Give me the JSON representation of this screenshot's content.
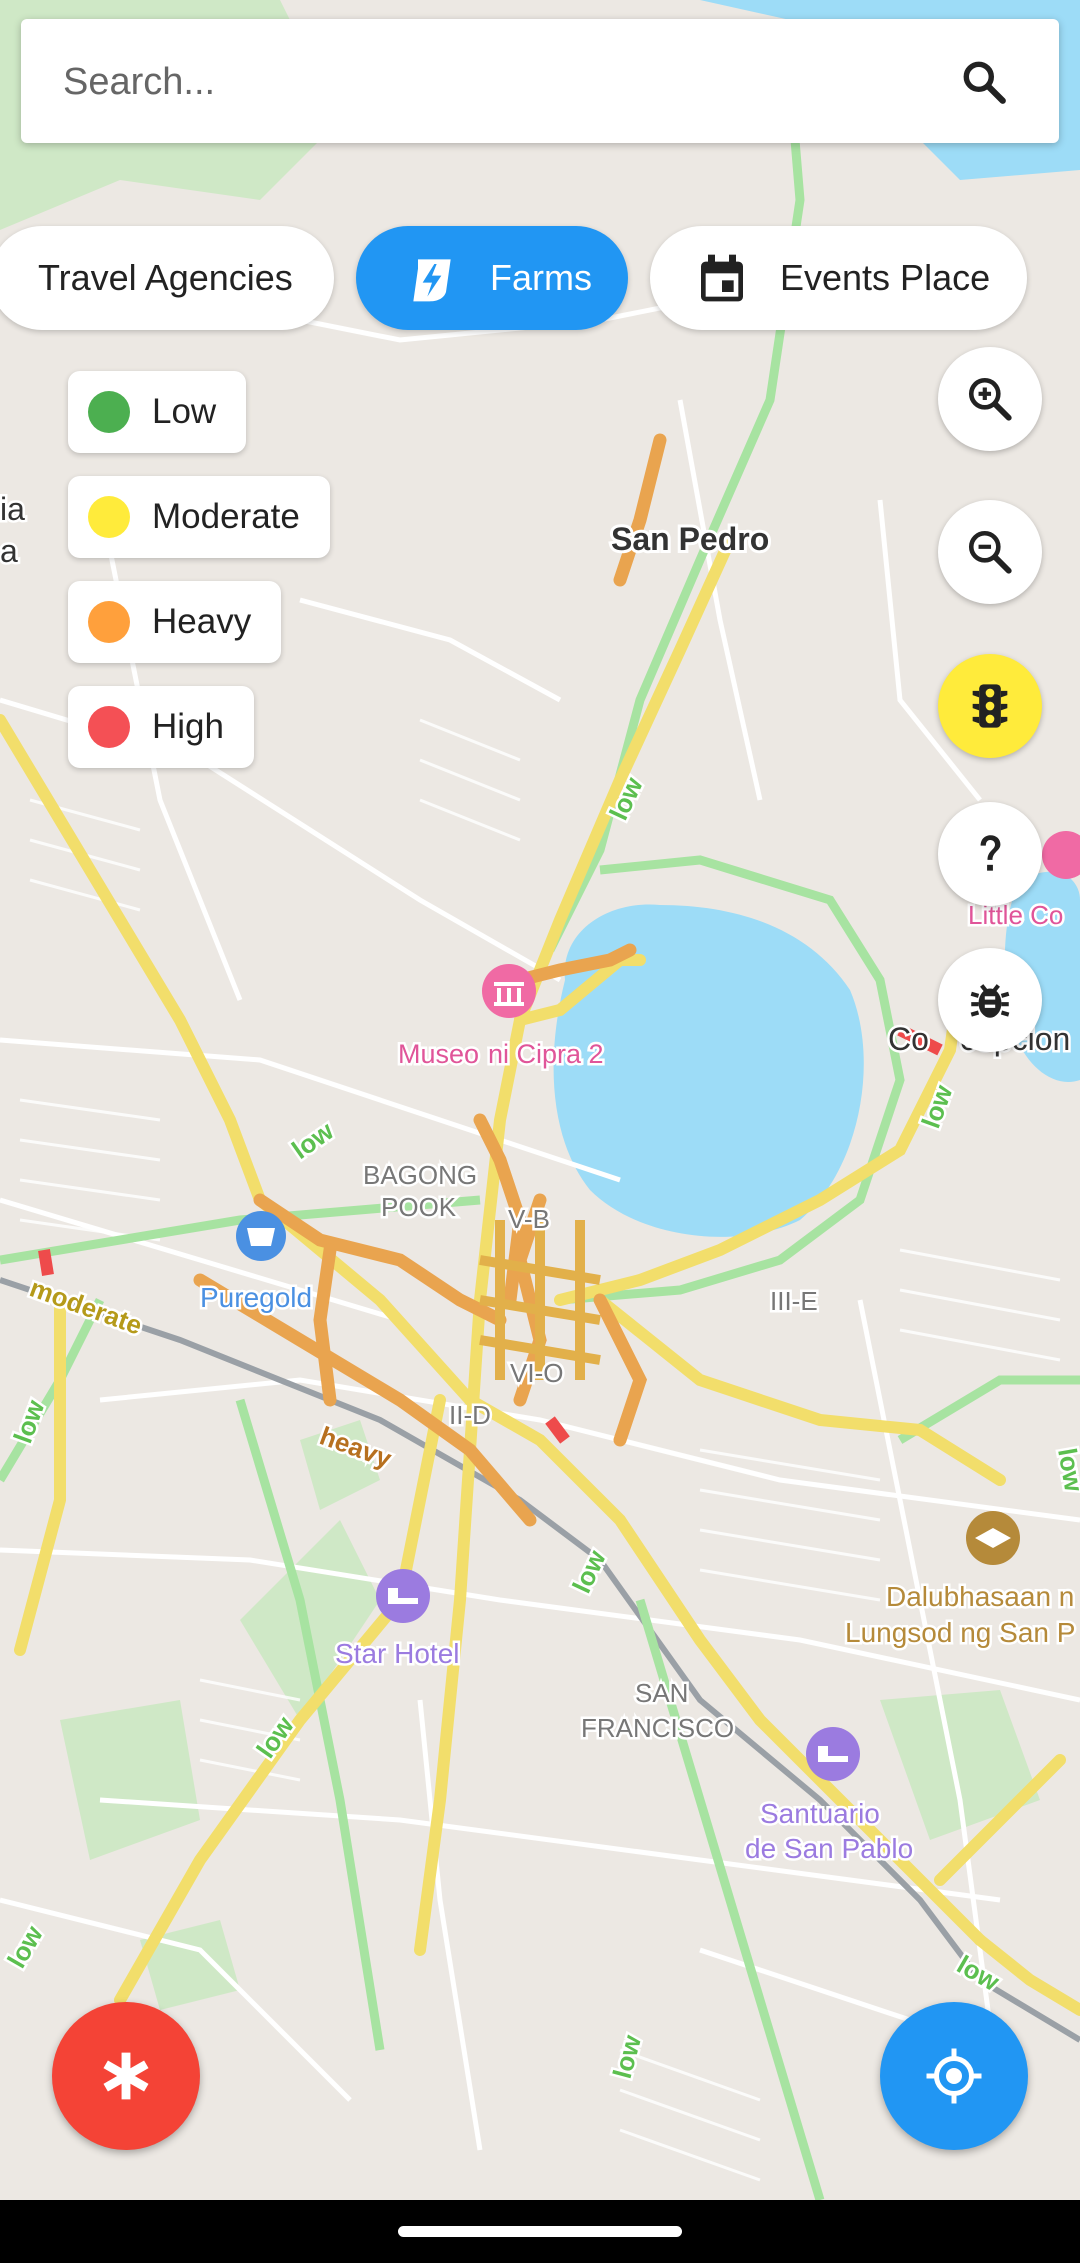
{
  "search": {
    "placeholder": "Search..."
  },
  "categories": [
    {
      "label": "Travel Agencies",
      "icon": "airplane-icon",
      "active": false
    },
    {
      "label": "Farms",
      "icon": "bolt-icon",
      "active": true
    },
    {
      "label": "Events Place",
      "icon": "calendar-icon",
      "active": false
    }
  ],
  "traffic_legend": [
    {
      "label": "Low",
      "color": "#4caf50"
    },
    {
      "label": "Moderate",
      "color": "#ffeb3b"
    },
    {
      "label": "Heavy",
      "color": "#ffa03c"
    },
    {
      "label": "High",
      "color": "#f45055"
    }
  ],
  "map_controls": [
    "zoom-in-icon",
    "zoom-out-icon",
    "traffic-light-icon",
    "help-icon",
    "bug-icon"
  ],
  "map": {
    "places": {
      "san_pedro": "San Pedro",
      "museo_a": "Museo",
      "museo_b": "ni Cipra 2",
      "bagong": "BAGONG",
      "pook": "POOK",
      "vb": "V-B",
      "puregold": "Puregold",
      "iiie": "III-E",
      "vio": "VI-O",
      "iid": "II-D",
      "concepcion_a": "Co",
      "concepcion_b": "cepcion",
      "little": "Little Co",
      "star_hotel": "Star Hotel",
      "san_a": "SAN",
      "san_b": "FRANCISCO",
      "santuario_a": "Santuario",
      "santuario_b": "de San Pablo",
      "dalub_a": "Dalubhasaan n",
      "dalub_b": "Lungsod ng San P",
      "edge_a": "ia",
      "edge_b": "a"
    },
    "road_labels": {
      "low": "low",
      "moderate": "moderate",
      "heavy": "heavy"
    }
  },
  "colors": {
    "accent": "#2196f3",
    "emergency": "#f44336",
    "lake": "#9ddcf7"
  }
}
